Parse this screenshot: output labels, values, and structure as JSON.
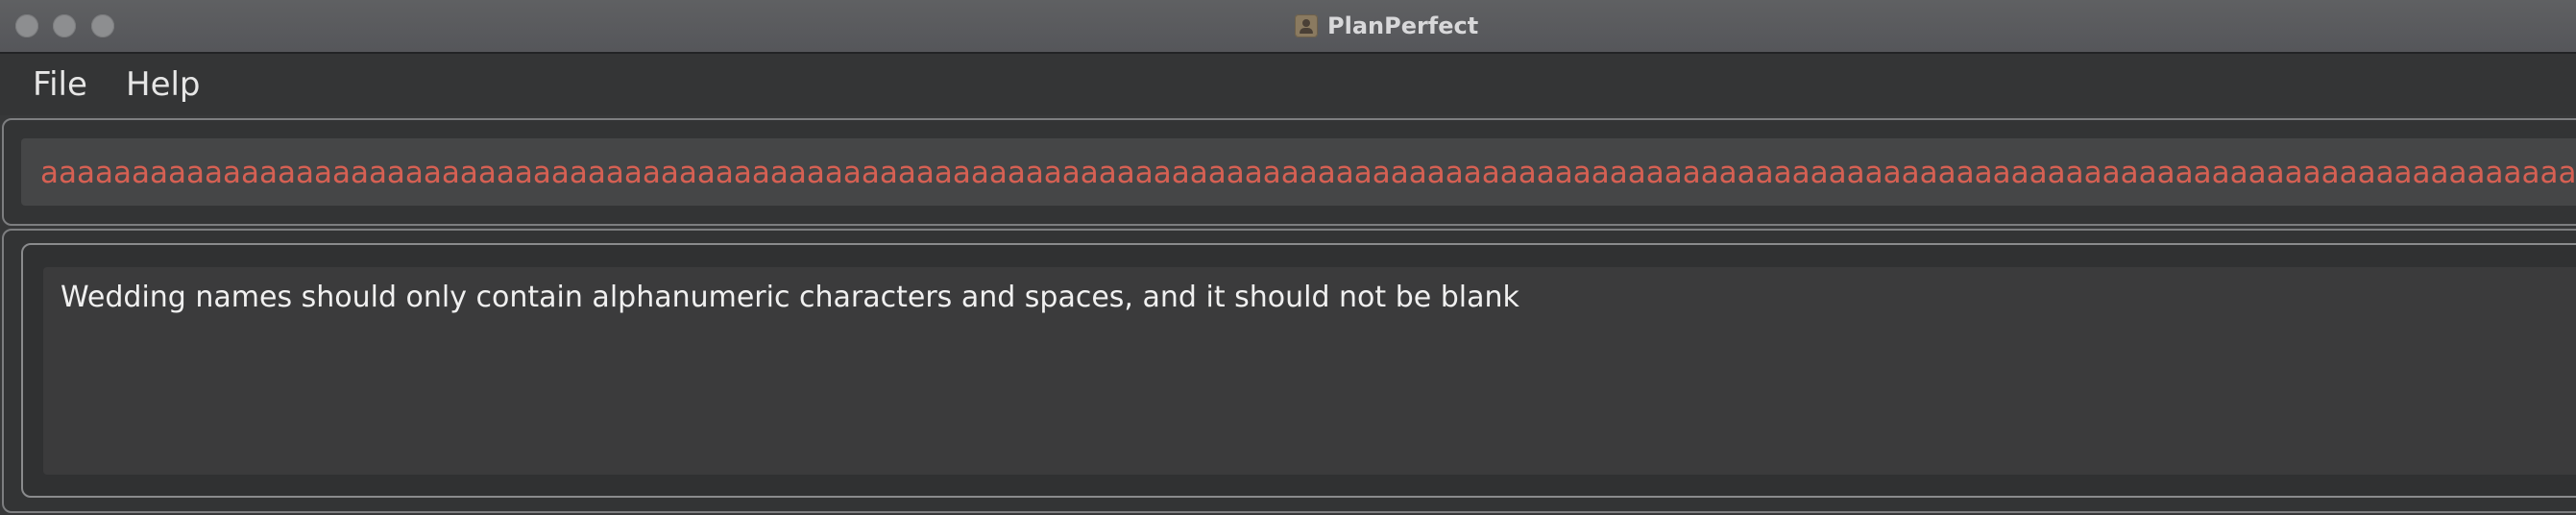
{
  "window": {
    "title": "PlanPerfect",
    "app_icon": "person-icon",
    "traffic_light_color": "#8d8e90"
  },
  "menu": {
    "items": [
      {
        "label": "File"
      },
      {
        "label": "Help"
      }
    ]
  },
  "command_box": {
    "value": "aaaaaaaaaaaaaaaaaaaaaaaaaaaaaaaaaaaaaaaaaaaaaaaaaaaaaaaaaaaaaaaaaaaaaaaaaaaaaaaaaaaaaaaaaaaaaaaaaaaaaaaaaaaaaaaaaaaaaaaaaaaaaaaaaaaaaaaaaaaaaaaaaaaaaaaaaaaaaaaaaaaaaaaaaaaaaaaaaaa",
    "text_color": "#d66053"
  },
  "result_display": {
    "text": "Wedding names should only contain alphanumeric characters and spaces, and it should not be blank"
  },
  "colors": {
    "titlebar": "#5f6062",
    "background": "#373839",
    "input_background": "#454647",
    "error_text": "#d66053"
  }
}
